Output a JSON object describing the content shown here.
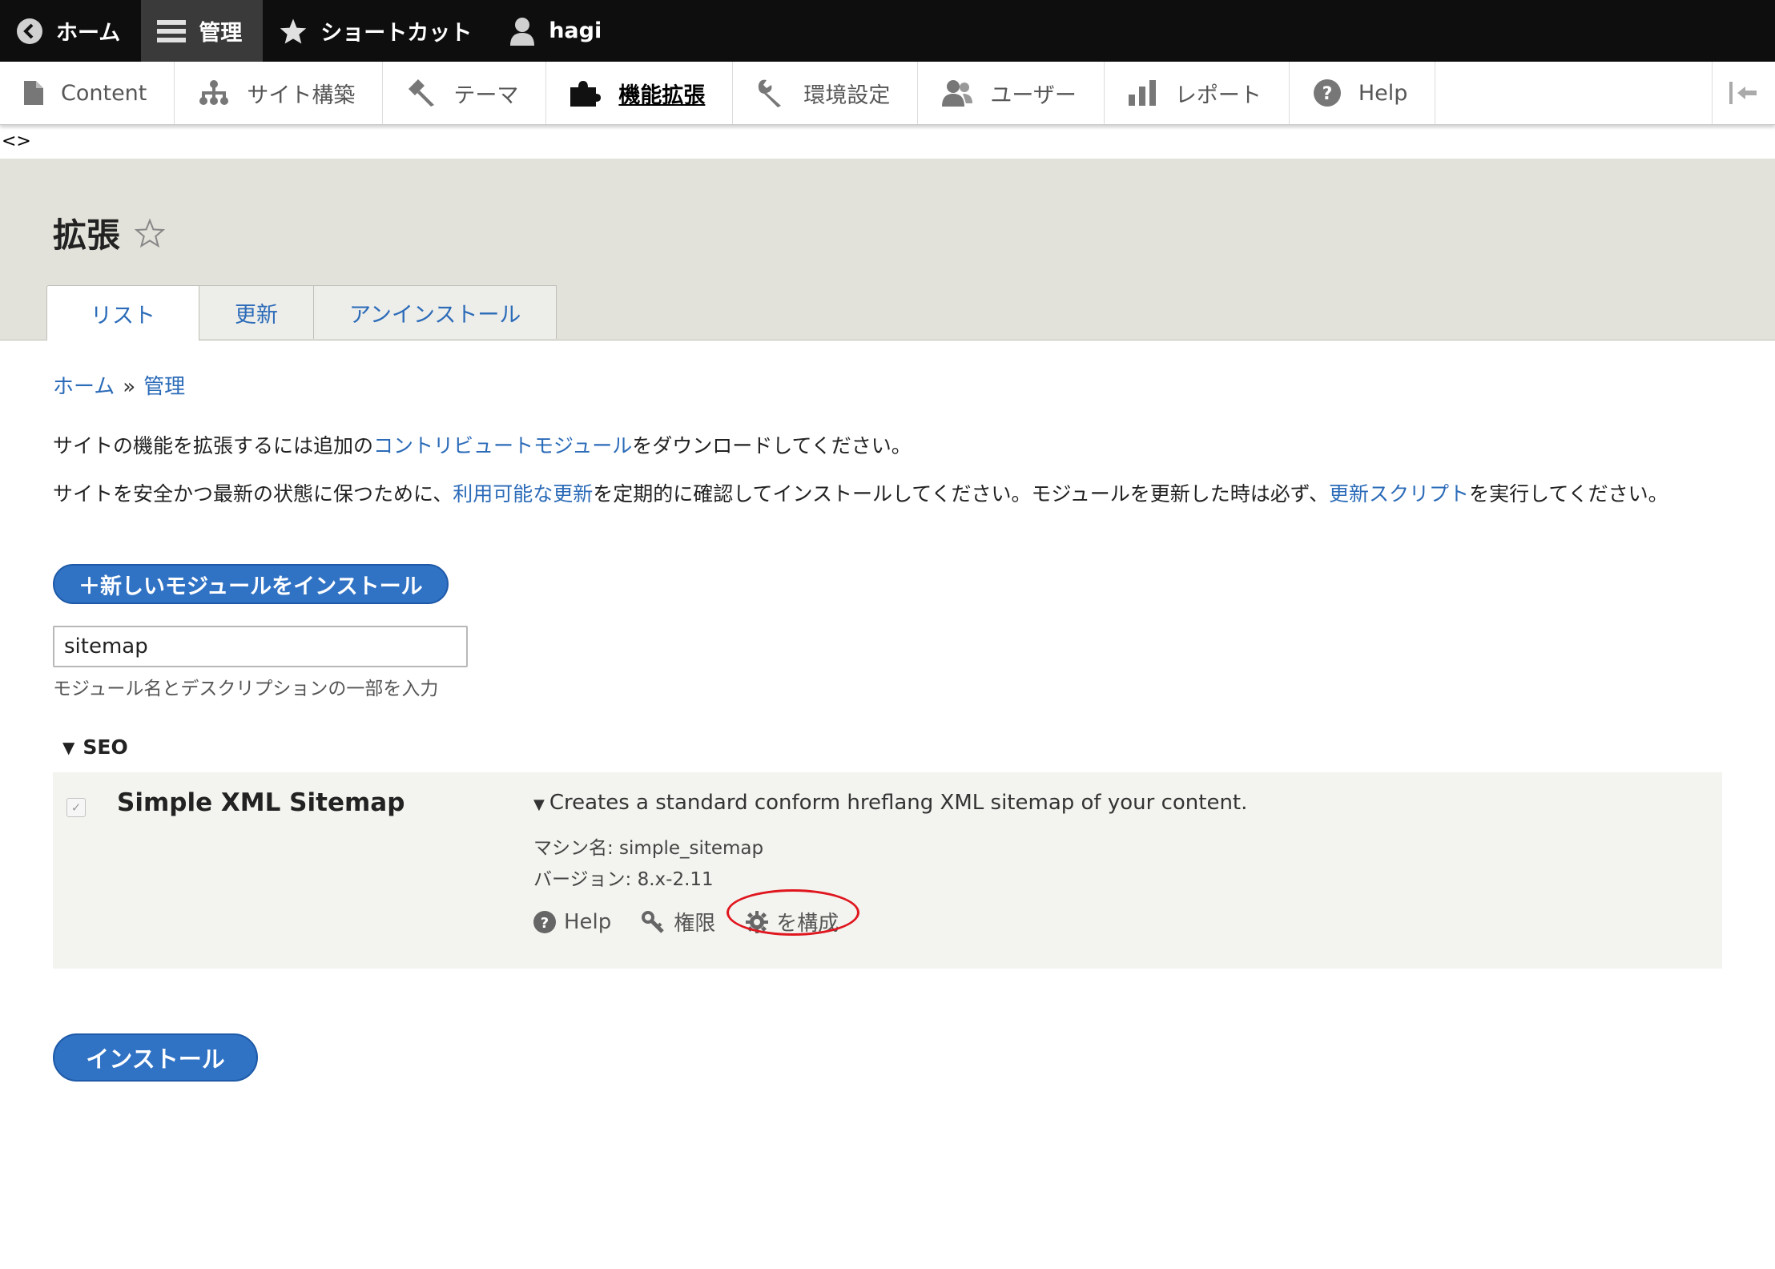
{
  "toolbar": {
    "home": "ホーム",
    "manage": "管理",
    "shortcuts": "ショートカット",
    "user": "hagi"
  },
  "tray": {
    "items": [
      {
        "label": "Content",
        "icon": "file-icon"
      },
      {
        "label": "サイト構築",
        "icon": "sitemap-icon"
      },
      {
        "label": "テーマ",
        "icon": "paintbrush-icon"
      },
      {
        "label": "機能拡張",
        "icon": "puzzle-icon",
        "active": true
      },
      {
        "label": "環境設定",
        "icon": "wrench-icon"
      },
      {
        "label": "ユーザー",
        "icon": "people-icon"
      },
      {
        "label": "レポート",
        "icon": "bar-chart-icon"
      },
      {
        "label": "Help",
        "icon": "help-icon"
      }
    ]
  },
  "brackets": "<>",
  "page": {
    "title": "拡張",
    "tabs": [
      "リスト",
      "更新",
      "アンインストール"
    ]
  },
  "breadcrumb": {
    "home": "ホーム",
    "sep": "»",
    "manage": "管理"
  },
  "intro": {
    "p1_before": "サイトの機能を拡張するには追加の",
    "p1_link": "コントリビュートモジュール",
    "p1_after": "をダウンロードしてください。",
    "p2_before": "サイトを安全かつ最新の状態に保つために、",
    "p2_link1": "利用可能な更新",
    "p2_middle": "を定期的に確認してインストールしてください。モジュールを更新した時は必ず、",
    "p2_link2": "更新スクリプト",
    "p2_after": "を実行してください。"
  },
  "add_module_button": "＋新しいモジュールをインストール",
  "filter": {
    "value": "sitemap",
    "description": "モジュール名とデスクリプションの一部を入力"
  },
  "group": {
    "name": "SEO"
  },
  "module": {
    "name": "Simple XML Sitemap",
    "checked": true,
    "description": "Creates a standard conform hreflang XML sitemap of your content.",
    "machine_name": "マシン名: simple_sitemap",
    "version": "バージョン: 8.x-2.11",
    "links": {
      "help": "Help",
      "permissions": "権限",
      "configure": "を構成"
    }
  },
  "install_button": "インストール",
  "colors": {
    "link": "#2b6bb8",
    "button": "#3072c4",
    "header_bg": "#e3e2da",
    "highlight": "#e0161e"
  }
}
